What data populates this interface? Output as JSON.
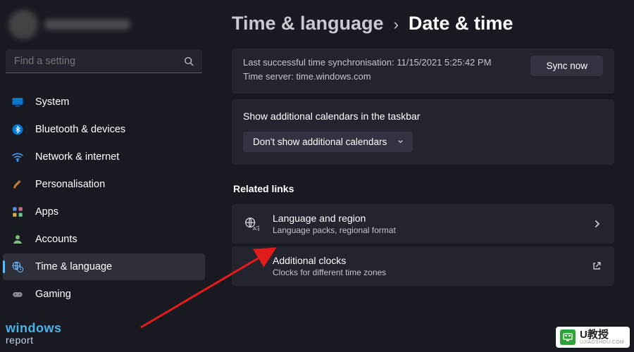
{
  "search": {
    "placeholder": "Find a setting"
  },
  "sidebar": {
    "items": [
      {
        "label": "System"
      },
      {
        "label": "Bluetooth & devices"
      },
      {
        "label": "Network & internet"
      },
      {
        "label": "Personalisation"
      },
      {
        "label": "Apps"
      },
      {
        "label": "Accounts"
      },
      {
        "label": "Time & language"
      },
      {
        "label": "Gaming"
      }
    ]
  },
  "breadcrumb": {
    "parent": "Time & language",
    "sep": "›",
    "current": "Date & time"
  },
  "sync": {
    "line1": "Last successful time synchronisation: 11/15/2021 5:25:42 PM",
    "line2": "Time server: time.windows.com",
    "button": "Sync now"
  },
  "calendars": {
    "title": "Show additional calendars in the taskbar",
    "selected": "Don't show additional calendars"
  },
  "section_related": "Related links",
  "links": [
    {
      "title": "Language and region",
      "sub": "Language packs, regional format"
    },
    {
      "title": "Additional clocks",
      "sub": "Clocks for different time zones"
    }
  ],
  "watermark": {
    "line1": "windows",
    "line2": "report"
  },
  "badge": {
    "title": "U教授",
    "sub": "UJIAOSHOU.COM"
  }
}
